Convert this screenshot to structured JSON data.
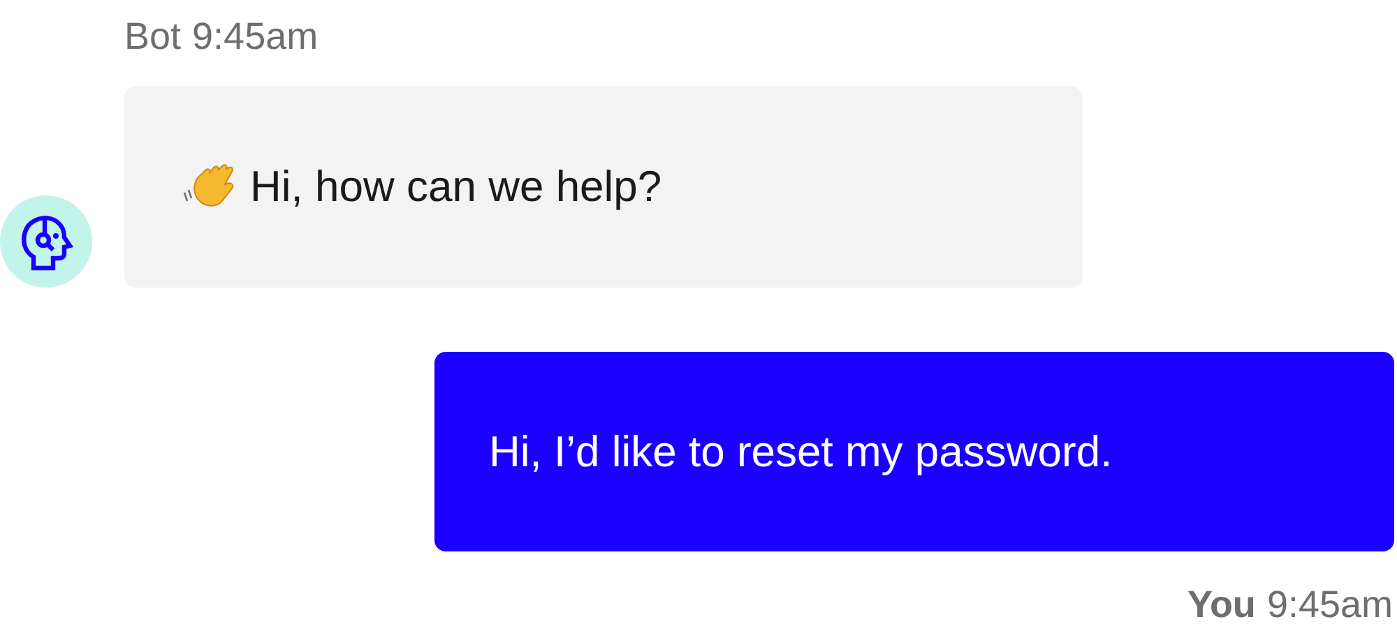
{
  "messages": [
    {
      "kind": "bot",
      "sender": "Bot",
      "time": "9:45am",
      "text": "Hi, how can we help?",
      "wave": true
    },
    {
      "kind": "user",
      "sender": "You",
      "time": "9:45am",
      "text": "Hi, I’d like to reset my password.",
      "wave": false
    }
  ]
}
